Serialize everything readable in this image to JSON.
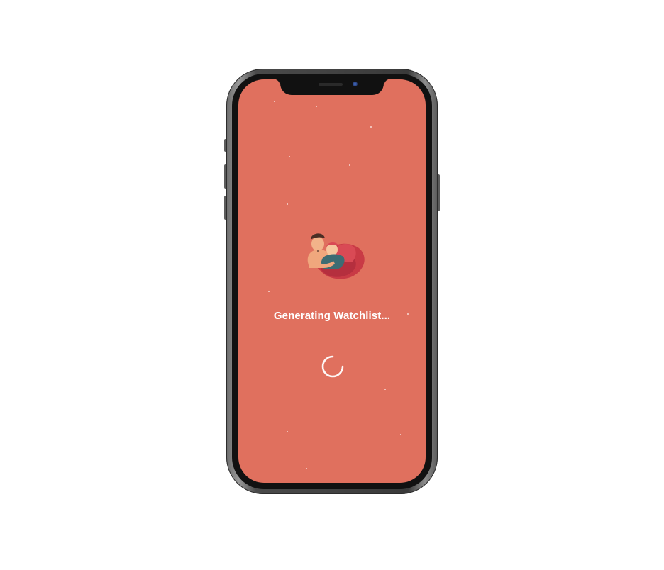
{
  "loading_screen": {
    "message": "Generating Watchlist...",
    "background_color": "#e0705e",
    "text_color": "#ffffff",
    "illustration": "couple-hug-illustration",
    "spinner": "loading-spinner-icon"
  },
  "device": {
    "frame": "smartphone-frame",
    "notch": "camera-notch"
  }
}
